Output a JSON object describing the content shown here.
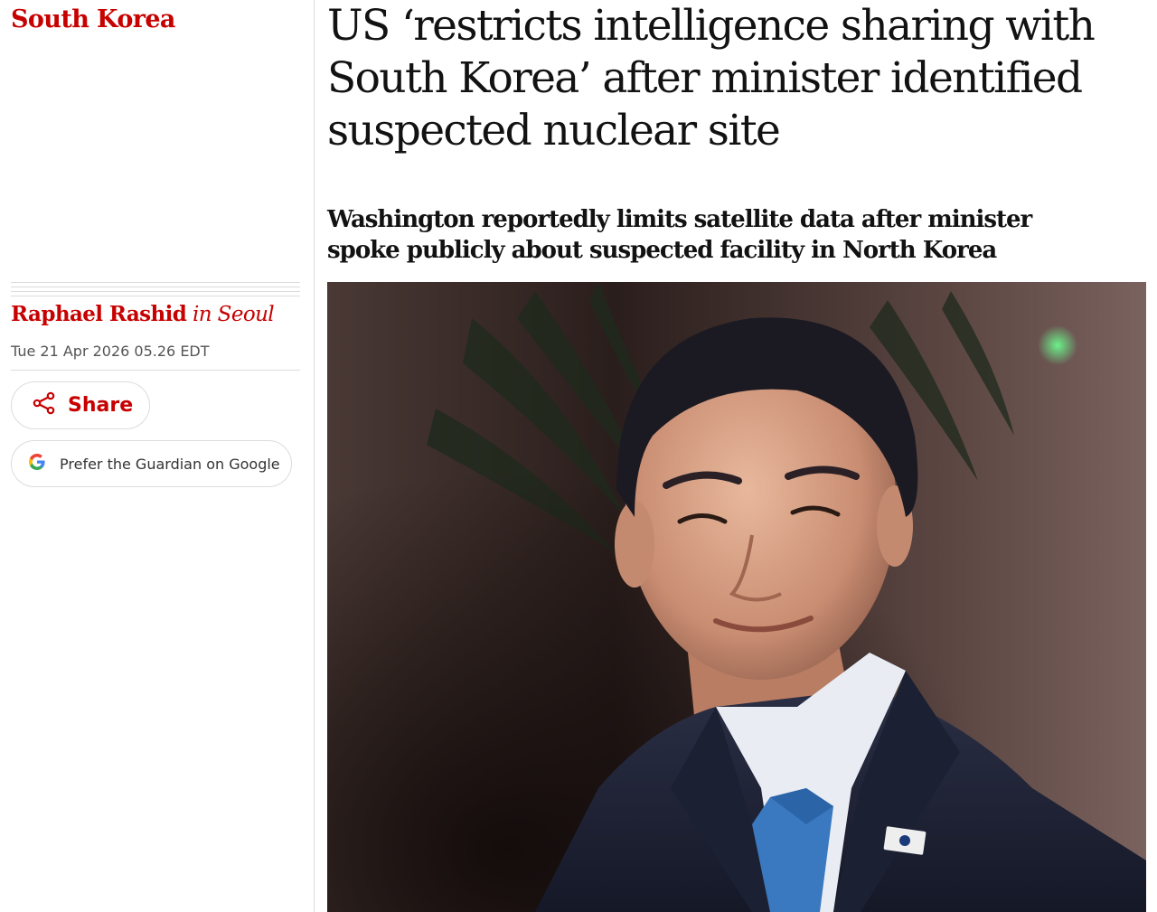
{
  "section": {
    "label": "South Korea"
  },
  "article": {
    "headline_lines": [
      "US ‘restricts intelligence sharing with",
      "South Korea’ after minister identified",
      "suspected nuclear site"
    ],
    "standfirst_lines": [
      "Washington reportedly limits satellite data after minister",
      "spoke publicly about suspected facility in North Korea"
    ],
    "byline_author": "Raphael Rashid",
    "byline_location": "in Seoul",
    "dateline": "Tue 21 Apr 2026 05.26 EDT"
  },
  "actions": {
    "share_label": "Share",
    "google_label": "Prefer the Guardian on Google"
  },
  "icons": {
    "share": "share-icon",
    "google": "google-g-icon"
  },
  "colors": {
    "accent": "#c70000",
    "text": "#121212",
    "meta": "#555555",
    "divider": "#dcdcdc"
  }
}
